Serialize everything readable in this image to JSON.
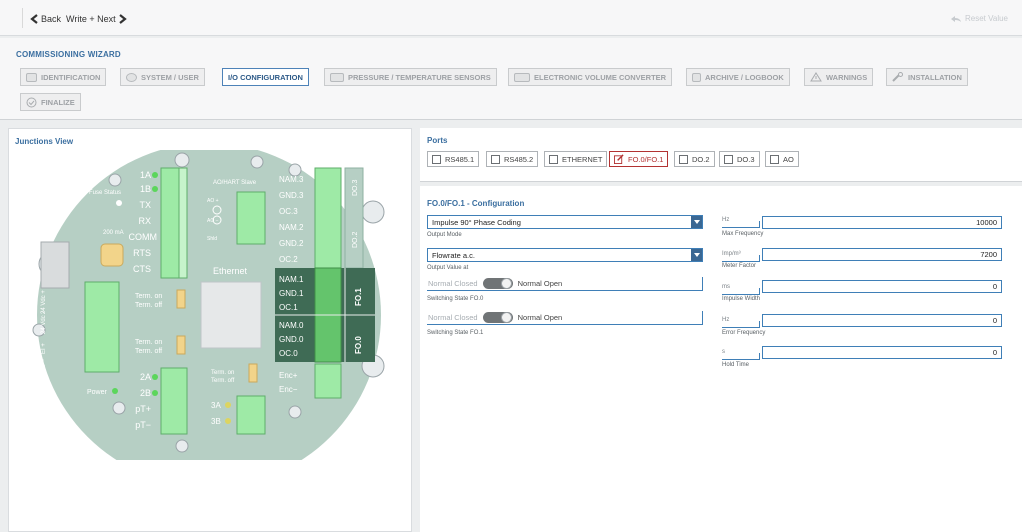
{
  "topbar": {
    "back_label": "Back",
    "write_next_label": "Write + Next",
    "reset_label": "Reset Value"
  },
  "wizard": {
    "title": "COMMISSIONING WIZARD",
    "steps": [
      {
        "label": "IDENTIFICATION",
        "icon": "id-card-icon",
        "active": false
      },
      {
        "label": "SYSTEM / USER",
        "icon": "user-icon",
        "active": false
      },
      {
        "label": "I/O CONFIGURATION",
        "icon": "",
        "active": true
      },
      {
        "label": "PRESSURE / TEMPERATURE SENSORS",
        "icon": "pt-sensor-icon",
        "active": false
      },
      {
        "label": "ELECTRONIC VOLUME CONVERTER",
        "icon": "evc-icon",
        "active": false
      },
      {
        "label": "ARCHIVE / LOGBOOK",
        "icon": "archive-icon",
        "active": false
      },
      {
        "label": "WARNINGS",
        "icon": "warning-icon",
        "active": false
      },
      {
        "label": "INSTALLATION",
        "icon": "wrench-icon",
        "active": false
      },
      {
        "label": "FINALIZE",
        "icon": "check-circle-icon",
        "active": false
      }
    ]
  },
  "junctions": {
    "title": "Junctions View",
    "board": {
      "left_labels": [
        "1A",
        "1B",
        "TX",
        "RX",
        "COMM",
        "RTS",
        "CTS"
      ],
      "fuse_label": "Fuse Status",
      "fuse_value": "200 mA",
      "voltage_labels": [
        "24 Vdc +",
        "24 Vdc −",
        "EI +",
        "EI −"
      ],
      "power_label": "Power",
      "bottom_left_labels": [
        "2A",
        "2B",
        "pT+",
        "pT−"
      ],
      "ao_label": "AO/HART Slave",
      "ao_pins": [
        "AO +",
        "AO −",
        "Shld"
      ],
      "right_labels": [
        "NAM.3",
        "GND.3",
        "OC.3",
        "NAM.2",
        "GND.2",
        "OC.2"
      ],
      "fo1_labels": [
        "NAM.1",
        "GND.1",
        "OC.1"
      ],
      "fo0_labels": [
        "NAM.0",
        "GND.0",
        "OC.0"
      ],
      "enc_labels": [
        "Enc+",
        "Enc−"
      ],
      "ethernet_label": "Ethernet",
      "term_labels": [
        "Term. on",
        "Term. off"
      ],
      "bottom_mid_labels": [
        "3A",
        "3B"
      ],
      "do_labels": [
        "DO.3",
        "DO.2"
      ],
      "fo_labels": [
        "FO.1",
        "FO.0"
      ]
    }
  },
  "ports": {
    "title": "Ports",
    "items": [
      {
        "label": "RS485.1",
        "active": false
      },
      {
        "label": "RS485.2",
        "active": false
      },
      {
        "label": "ETHERNET",
        "active": false
      },
      {
        "label": "FO.0/FO.1",
        "active": true
      },
      {
        "label": "DO.2",
        "active": false
      },
      {
        "label": "DO.3",
        "active": false
      },
      {
        "label": "AO",
        "active": false
      }
    ]
  },
  "config": {
    "title": "FO.0/FO.1 - Configuration",
    "output_mode": {
      "value": "Impulse 90° Phase Coding",
      "label": "Output Mode"
    },
    "output_value": {
      "value": "Flowrate a.c.",
      "label": "Output Value at"
    },
    "fo0": {
      "off_label": "Normal Closed",
      "on_label": "Normal Open",
      "label": "Switching State FO.0"
    },
    "fo1": {
      "off_label": "Normal Closed",
      "on_label": "Normal Open",
      "label": "Switching State FO.1"
    },
    "fields": [
      {
        "unit": "Hz",
        "value": "10000",
        "label": "Max Frequency"
      },
      {
        "unit": "Imp/m³",
        "value": "7200",
        "label": "Meter Factor"
      },
      {
        "unit": "ms",
        "value": "0",
        "label": "Impulse Width"
      },
      {
        "unit": "Hz",
        "value": "0",
        "label": "Error Frequency"
      },
      {
        "unit": "s",
        "value": "0",
        "label": "Hold Time"
      }
    ]
  },
  "colors": {
    "accent": "#3b6fa0",
    "active_port": "#b23232",
    "board_green": "#b6cfc4",
    "fo_highlight": "#3f6b55"
  }
}
